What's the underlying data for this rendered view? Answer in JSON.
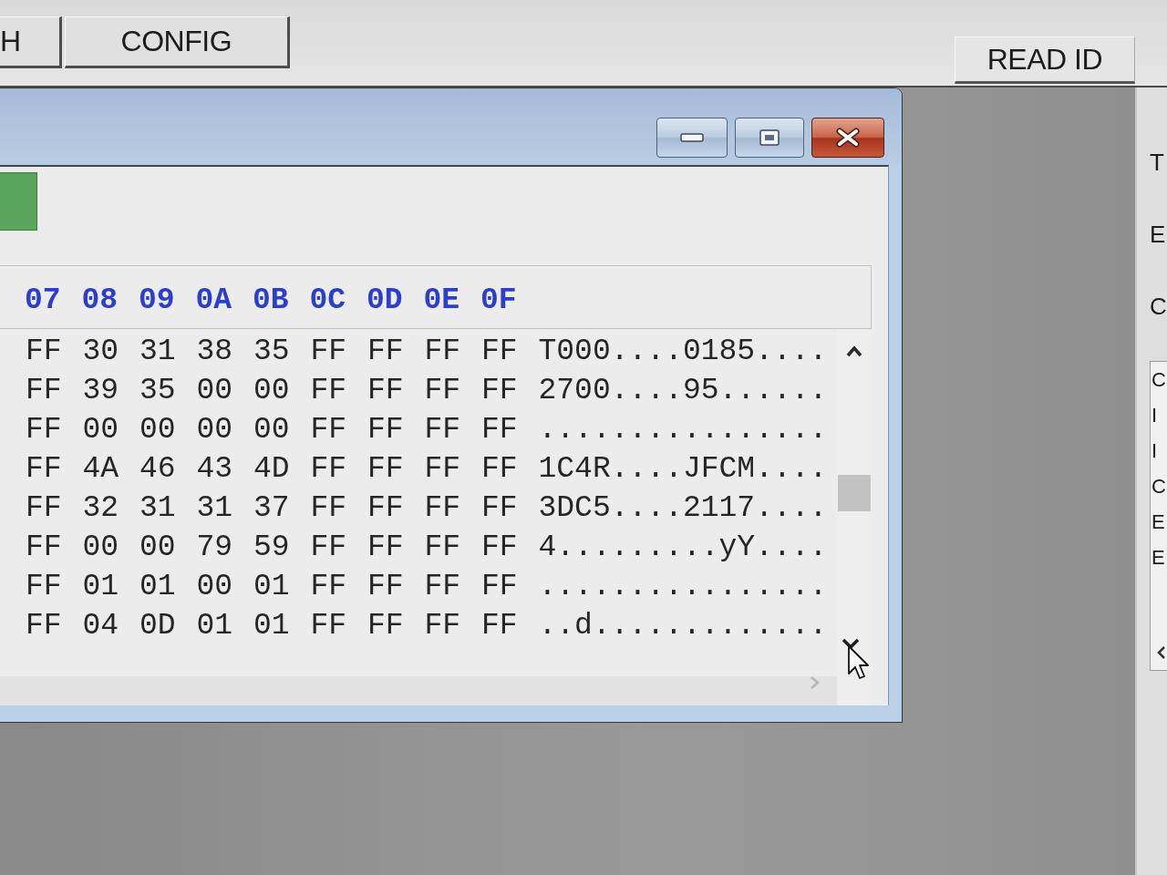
{
  "toolbar": {
    "tabs": [
      {
        "label": "H",
        "selected": false
      },
      {
        "label": "CONFIG",
        "selected": false
      }
    ],
    "read_id_button": "READ ID"
  },
  "hex_view": {
    "columns": [
      "07",
      "08",
      "09",
      "0A",
      "0B",
      "0C",
      "0D",
      "0E",
      "0F"
    ],
    "rows": [
      {
        "bytes": [
          "FF",
          "30",
          "31",
          "38",
          "35",
          "FF",
          "FF",
          "FF",
          "FF"
        ],
        "ascii": "T000....0185...."
      },
      {
        "bytes": [
          "FF",
          "39",
          "35",
          "00",
          "00",
          "FF",
          "FF",
          "FF",
          "FF"
        ],
        "ascii": "2700....95......"
      },
      {
        "bytes": [
          "FF",
          "00",
          "00",
          "00",
          "00",
          "FF",
          "FF",
          "FF",
          "FF"
        ],
        "ascii": "................"
      },
      {
        "bytes": [
          "FF",
          "4A",
          "46",
          "43",
          "4D",
          "FF",
          "FF",
          "FF",
          "FF"
        ],
        "ascii": "1C4R....JFCM...."
      },
      {
        "bytes": [
          "FF",
          "32",
          "31",
          "31",
          "37",
          "FF",
          "FF",
          "FF",
          "FF"
        ],
        "ascii": "3DC5....2117...."
      },
      {
        "bytes": [
          "FF",
          "00",
          "00",
          "79",
          "59",
          "FF",
          "FF",
          "FF",
          "FF"
        ],
        "ascii": "4.........yY...."
      },
      {
        "bytes": [
          "FF",
          "01",
          "01",
          "00",
          "01",
          "FF",
          "FF",
          "FF",
          "FF"
        ],
        "ascii": "................"
      },
      {
        "bytes": [
          "FF",
          "04",
          "0D",
          "01",
          "01",
          "FF",
          "FF",
          "FF",
          "FF"
        ],
        "ascii": "..d............."
      }
    ]
  },
  "side_panel": {
    "labels": [
      "T",
      "E",
      "C"
    ],
    "list_items": [
      "C",
      "I",
      "I",
      "C",
      "E",
      "E"
    ]
  }
}
